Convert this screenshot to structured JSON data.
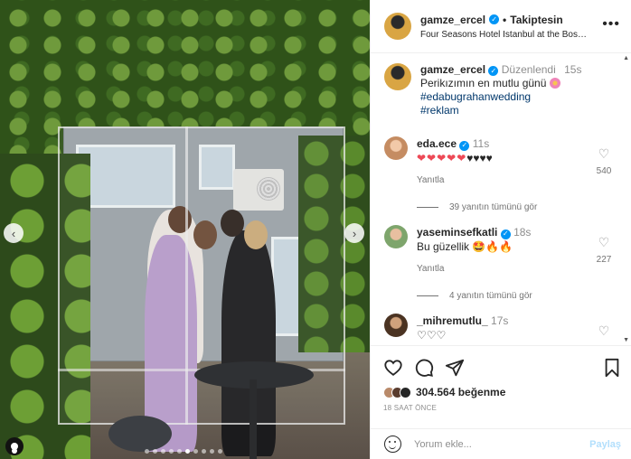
{
  "post": {
    "username": "gamze_ercel",
    "follow_status": "Takiptesin",
    "location": "Four Seasons Hotel Istanbul at the Bos…",
    "caption": {
      "username": "gamze_ercel",
      "edited_label": "Düzenlendi",
      "time": "15s",
      "text": "Perikızımın en mutlu günü",
      "hashtag1": "#edabugrahanwedding",
      "hashtag2": "#reklam"
    },
    "comments": [
      {
        "username": "eda.ece",
        "verified": true,
        "time": "11s",
        "text_red_hearts": "❤❤❤❤❤",
        "text_black_hearts": "♥♥♥♥",
        "reply_label": "Yanıtla",
        "likes": "540",
        "view_replies": "39 yanıtın tümünü gör"
      },
      {
        "username": "yaseminsefkatli",
        "verified": true,
        "time": "18s",
        "text": "Bu güzellik",
        "emojis": "🤩🔥🔥",
        "reply_label": "Yanıtla",
        "likes": "227",
        "view_replies": "4 yanıtın tümünü gör"
      },
      {
        "username": "_mihremutlu_",
        "verified": false,
        "time": "17s",
        "text": "♡♡♡"
      }
    ],
    "likes_count": "304.564 beğenme",
    "time_ago": "18 SAAT ÖNCE",
    "comment_placeholder": "Yorum ekle...",
    "post_button": "Paylaş",
    "carousel": {
      "total": 10,
      "active_index": 5
    }
  },
  "colors": {
    "accent": "#0095f6",
    "link": "#00376b",
    "muted": "#8e8e8e",
    "heart_red": "#ed4956"
  },
  "icons": [
    "more-icon",
    "heart-icon",
    "comment-icon",
    "share-icon",
    "bookmark-icon",
    "emoji-icon",
    "verified-icon",
    "chevron-left-icon",
    "chevron-right-icon",
    "tag-user-icon"
  ]
}
